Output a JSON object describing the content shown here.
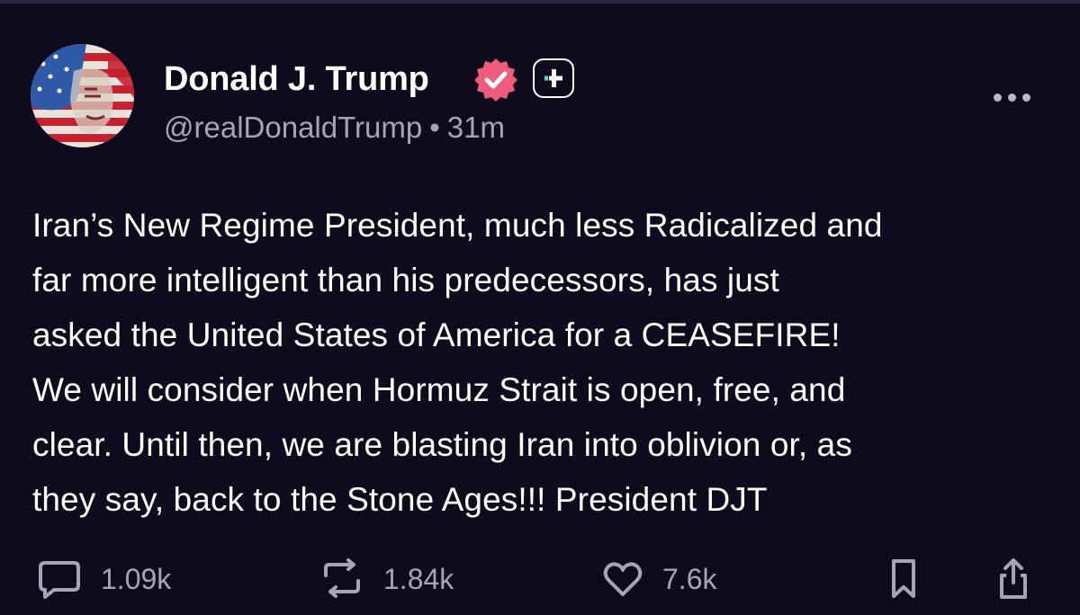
{
  "author": {
    "name": "Donald J. Trump",
    "handle": "@realDonaldTrump",
    "separator": "•",
    "time": "31m",
    "avatar_icon": "flag-portrait-avatar",
    "verified_icon": "verified-badge-icon",
    "verified_color": "#ef5b7b"
  },
  "post": {
    "text": "Iran’s New Regime President, much less Radicalized and\nfar more intelligent than his predecessors, has just\nasked the United States of America for a CEASEFIRE!\nWe will consider when Hormuz Strait is open, free, and\nclear. Until then, we are blasting Iran into oblivion or, as\nthey say, back to the Stone Ages!!! President DJT"
  },
  "actions": {
    "replies": "1.09k",
    "reposts": "1.84k",
    "likes": "7.6k"
  },
  "colors": {
    "background": "#0e0b1c",
    "muted_text": "#a8a4b8",
    "accent": "#ef5b7b"
  }
}
